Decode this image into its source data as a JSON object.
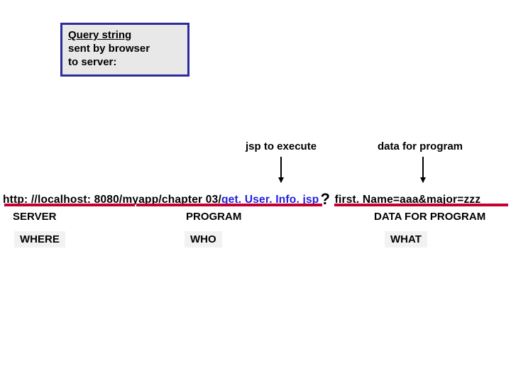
{
  "title_box": {
    "line1": "Query string",
    "line2": "sent by browser",
    "line3": "to server:"
  },
  "mid": {
    "jsp": "jsp to execute",
    "data": "data for program"
  },
  "url": {
    "server_prefix": "http: //localhost: 8080/",
    "program_black": "myapp/chapter 03/",
    "program_blue": "get. User. Info. jsp",
    "question_mark": "?",
    "data_segment": "first. Name=aaa&major=zzz"
  },
  "segments": {
    "server": {
      "label": "SERVER",
      "role": "WHERE"
    },
    "program": {
      "label": "PROGRAM",
      "role": "WHO"
    },
    "data": {
      "label": "DATA FOR PROGRAM",
      "role": "WHAT"
    }
  }
}
